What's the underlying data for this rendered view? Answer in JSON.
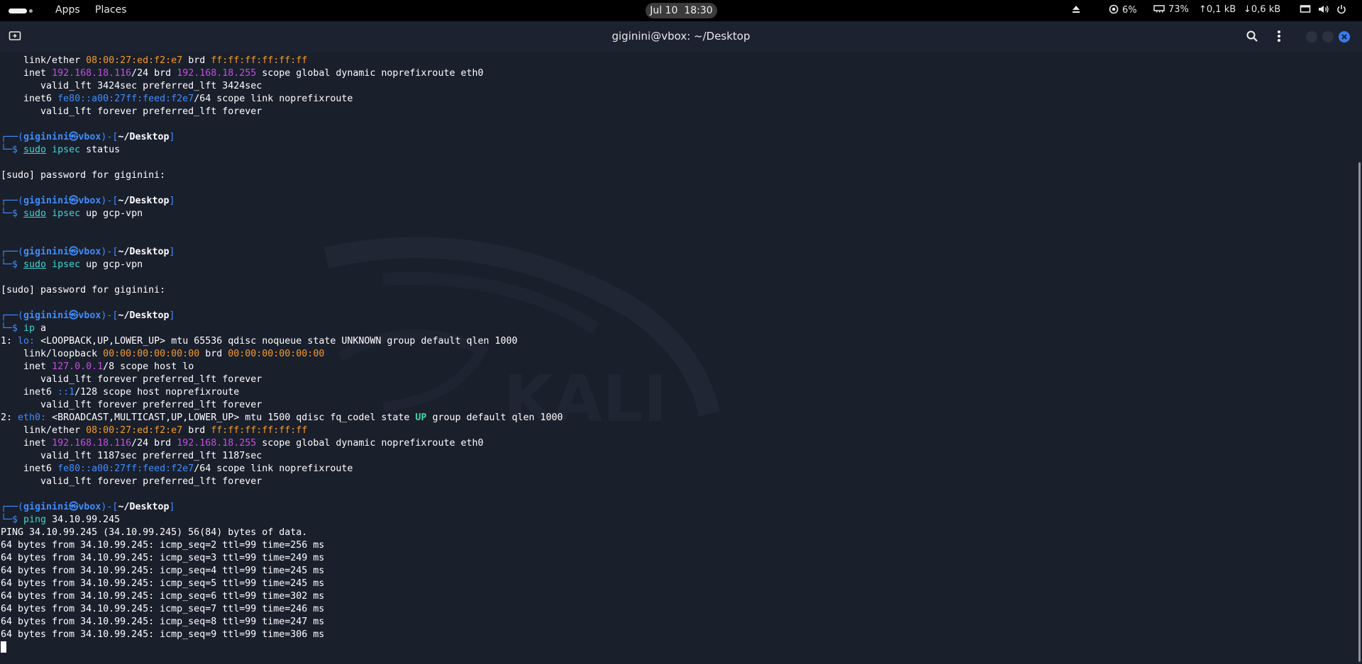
{
  "topbar": {
    "apps_label": "Apps",
    "places_label": "Places",
    "clock_date": "Jul 10",
    "clock_time": "18:30",
    "cpu": "6%",
    "memory": "73%",
    "net_up": "0,1 kB",
    "net_down": "0,6 kB"
  },
  "window": {
    "title": "giginini@vbox: ~/Desktop"
  },
  "colors": {
    "mac": "#f79b28",
    "ipv4": "#c24fe0",
    "ipv6": "#3f8dfd",
    "prompt": "#3f8dfd",
    "command": "#3ed6d1",
    "close_button": "#367bf0"
  },
  "terminal": {
    "prompt": {
      "user": "giginini",
      "at_symbol": "㉿",
      "host": "vbox",
      "path": "~/Desktop"
    },
    "lines": [
      [
        {
          "t": "    link/ether "
        },
        {
          "t": "08:00:27:ed:f2:e7",
          "c": "mac"
        },
        {
          "t": " brd "
        },
        {
          "t": "ff:ff:ff:ff:ff:ff",
          "c": "mac"
        }
      ],
      [
        {
          "t": "    inet "
        },
        {
          "t": "192.168.18.116",
          "c": "ip"
        },
        {
          "t": "/24 brd "
        },
        {
          "t": "192.168.18.255",
          "c": "ip"
        },
        {
          "t": " scope global dynamic noprefixroute eth0"
        }
      ],
      [
        {
          "t": "       valid_lft 3424sec preferred_lft 3424sec"
        }
      ],
      [
        {
          "t": "    inet6 "
        },
        {
          "t": "fe80::a00:27ff:feed:f2e7",
          "c": "ip6"
        },
        {
          "t": "/64 scope link noprefixroute"
        }
      ],
      [
        {
          "t": "       valid_lft forever preferred_lft forever"
        }
      ],
      [
        {
          "t": ""
        }
      ],
      [
        {
          "t": "┌──(",
          "c": "frame"
        },
        {
          "t": "giginini㉿vbox",
          "c": "user"
        },
        {
          "t": ")-[",
          "c": "frame"
        },
        {
          "t": "~/Desktop",
          "c": "path"
        },
        {
          "t": "]",
          "c": "frame"
        }
      ],
      [
        {
          "t": "└─",
          "c": "frame"
        },
        {
          "t": "$ ",
          "c": "frame"
        },
        {
          "t": "sudo",
          "c": "sudo"
        },
        {
          "t": " "
        },
        {
          "t": "ipsec",
          "c": "cmd"
        },
        {
          "t": " status"
        }
      ],
      [
        {
          "t": ""
        }
      ],
      [
        {
          "t": "[sudo] password for giginini:"
        }
      ],
      [
        {
          "t": ""
        }
      ],
      [
        {
          "t": "┌──(",
          "c": "frame"
        },
        {
          "t": "giginini㉿vbox",
          "c": "user"
        },
        {
          "t": ")-[",
          "c": "frame"
        },
        {
          "t": "~/Desktop",
          "c": "path"
        },
        {
          "t": "]",
          "c": "frame"
        }
      ],
      [
        {
          "t": "└─",
          "c": "frame"
        },
        {
          "t": "$ ",
          "c": "frame"
        },
        {
          "t": "sudo",
          "c": "sudo"
        },
        {
          "t": " "
        },
        {
          "t": "ipsec",
          "c": "cmd"
        },
        {
          "t": " up gcp-vpn"
        }
      ],
      [
        {
          "t": ""
        }
      ],
      [
        {
          "t": ""
        }
      ],
      [
        {
          "t": "┌──(",
          "c": "frame"
        },
        {
          "t": "giginini㉿vbox",
          "c": "user"
        },
        {
          "t": ")-[",
          "c": "frame"
        },
        {
          "t": "~/Desktop",
          "c": "path"
        },
        {
          "t": "]",
          "c": "frame"
        }
      ],
      [
        {
          "t": "└─",
          "c": "frame"
        },
        {
          "t": "$ ",
          "c": "frame"
        },
        {
          "t": "sudo",
          "c": "sudo"
        },
        {
          "t": " "
        },
        {
          "t": "ipsec",
          "c": "cmd"
        },
        {
          "t": " up gcp-vpn"
        }
      ],
      [
        {
          "t": ""
        }
      ],
      [
        {
          "t": "[sudo] password for giginini:"
        }
      ],
      [
        {
          "t": ""
        }
      ],
      [
        {
          "t": "┌──(",
          "c": "frame"
        },
        {
          "t": "giginini㉿vbox",
          "c": "user"
        },
        {
          "t": ")-[",
          "c": "frame"
        },
        {
          "t": "~/Desktop",
          "c": "path"
        },
        {
          "t": "]",
          "c": "frame"
        }
      ],
      [
        {
          "t": "└─",
          "c": "frame"
        },
        {
          "t": "$ ",
          "c": "frame"
        },
        {
          "t": "ip",
          "c": "cmd"
        },
        {
          "t": " a"
        }
      ],
      [
        {
          "t": "1: "
        },
        {
          "t": "lo:",
          "c": "iface"
        },
        {
          "t": " <LOOPBACK,UP,LOWER_UP> mtu 65536 qdisc noqueue state UNKNOWN group default qlen 1000"
        }
      ],
      [
        {
          "t": "    link/loopback "
        },
        {
          "t": "00:00:00:00:00:00",
          "c": "mac"
        },
        {
          "t": " brd "
        },
        {
          "t": "00:00:00:00:00:00",
          "c": "mac"
        }
      ],
      [
        {
          "t": "    inet "
        },
        {
          "t": "127.0.0.1",
          "c": "ip"
        },
        {
          "t": "/8 scope host lo"
        }
      ],
      [
        {
          "t": "       valid_lft forever preferred_lft forever"
        }
      ],
      [
        {
          "t": "    inet6 "
        },
        {
          "t": "::1",
          "c": "ip6"
        },
        {
          "t": "/128 scope host noprefixroute"
        }
      ],
      [
        {
          "t": "       valid_lft forever preferred_lft forever"
        }
      ],
      [
        {
          "t": "2: "
        },
        {
          "t": "eth0:",
          "c": "iface"
        },
        {
          "t": " <BROADCAST,MULTICAST,UP,LOWER_UP> mtu 1500 qdisc fq_codel state "
        },
        {
          "t": "UP",
          "c": "up"
        },
        {
          "t": " group default qlen 1000"
        }
      ],
      [
        {
          "t": "    link/ether "
        },
        {
          "t": "08:00:27:ed:f2:e7",
          "c": "mac"
        },
        {
          "t": " brd "
        },
        {
          "t": "ff:ff:ff:ff:ff:ff",
          "c": "mac"
        }
      ],
      [
        {
          "t": "    inet "
        },
        {
          "t": "192.168.18.116",
          "c": "ip"
        },
        {
          "t": "/24 brd "
        },
        {
          "t": "192.168.18.255",
          "c": "ip"
        },
        {
          "t": " scope global dynamic noprefixroute eth0"
        }
      ],
      [
        {
          "t": "       valid_lft 1187sec preferred_lft 1187sec"
        }
      ],
      [
        {
          "t": "    inet6 "
        },
        {
          "t": "fe80::a00:27ff:feed:f2e7",
          "c": "ip6"
        },
        {
          "t": "/64 scope link noprefixroute"
        }
      ],
      [
        {
          "t": "       valid_lft forever preferred_lft forever"
        }
      ],
      [
        {
          "t": ""
        }
      ],
      [
        {
          "t": "┌──(",
          "c": "frame"
        },
        {
          "t": "giginini㉿vbox",
          "c": "user"
        },
        {
          "t": ")-[",
          "c": "frame"
        },
        {
          "t": "~/Desktop",
          "c": "path"
        },
        {
          "t": "]",
          "c": "frame"
        }
      ],
      [
        {
          "t": "└─",
          "c": "frame"
        },
        {
          "t": "$ ",
          "c": "frame"
        },
        {
          "t": "ping",
          "c": "cmd"
        },
        {
          "t": " 34.10.99.245"
        }
      ],
      [
        {
          "t": "PING 34.10.99.245 (34.10.99.245) 56(84) bytes of data."
        }
      ],
      [
        {
          "t": "64 bytes from 34.10.99.245: icmp_seq=2 ttl=99 time=256 ms"
        }
      ],
      [
        {
          "t": "64 bytes from 34.10.99.245: icmp_seq=3 ttl=99 time=249 ms"
        }
      ],
      [
        {
          "t": "64 bytes from 34.10.99.245: icmp_seq=4 ttl=99 time=245 ms"
        }
      ],
      [
        {
          "t": "64 bytes from 34.10.99.245: icmp_seq=5 ttl=99 time=245 ms"
        }
      ],
      [
        {
          "t": "64 bytes from 34.10.99.245: icmp_seq=6 ttl=99 time=302 ms"
        }
      ],
      [
        {
          "t": "64 bytes from 34.10.99.245: icmp_seq=7 ttl=99 time=246 ms"
        }
      ],
      [
        {
          "t": "64 bytes from 34.10.99.245: icmp_seq=8 ttl=99 time=247 ms"
        }
      ],
      [
        {
          "t": "64 bytes from 34.10.99.245: icmp_seq=9 ttl=99 time=306 ms"
        }
      ]
    ]
  }
}
